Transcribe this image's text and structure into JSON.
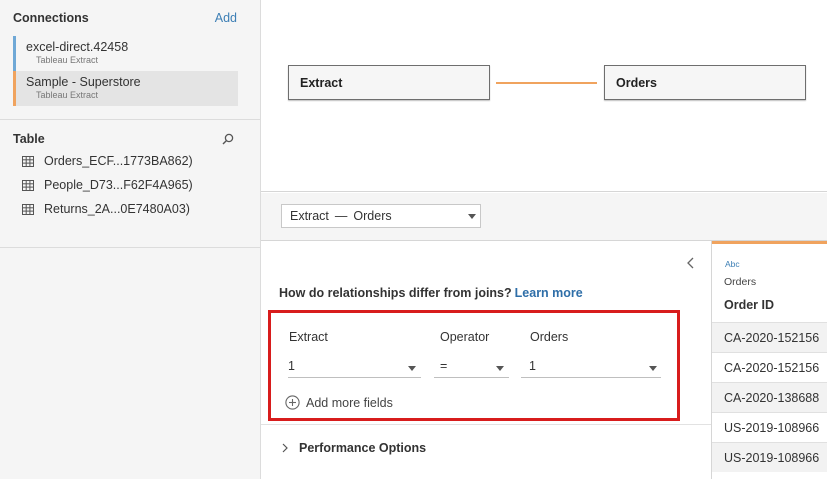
{
  "sidebar": {
    "connections_title": "Connections",
    "add_label": "Add",
    "connections": [
      {
        "name": "excel-direct.42458",
        "type": "Tableau Extract",
        "accent": "#6fa8d6"
      },
      {
        "name": "Sample - Superstore",
        "type": "Tableau Extract",
        "accent": "#f0a35e"
      }
    ],
    "table_title": "Table",
    "search_icon": "search-icon",
    "tables": [
      {
        "name": "Orders_ECF...1773BA862)"
      },
      {
        "name": "People_D73...F62F4A965)"
      },
      {
        "name": "Returns_2A...0E7480A03)"
      }
    ]
  },
  "canvas": {
    "left_node": "Extract",
    "right_node": "Orders",
    "relationship_color": "#f0a35e"
  },
  "relation_bar": {
    "left": "Extract",
    "separator": "—",
    "right": "Orders"
  },
  "panel": {
    "question": "How do relationships differ from joins?",
    "learn_more": "Learn more",
    "headers": {
      "left": "Extract",
      "operator": "Operator",
      "right": "Orders"
    },
    "values": {
      "left": "1",
      "operator": "=",
      "right": "1"
    },
    "add_more": "Add more fields",
    "performance": "Performance Options"
  },
  "preview": {
    "type_label": "Abc",
    "source": "Orders",
    "column": "Order ID",
    "rows": [
      "CA-2020-152156",
      "CA-2020-152156",
      "CA-2020-138688",
      "US-2019-108966",
      "US-2019-108966"
    ]
  }
}
